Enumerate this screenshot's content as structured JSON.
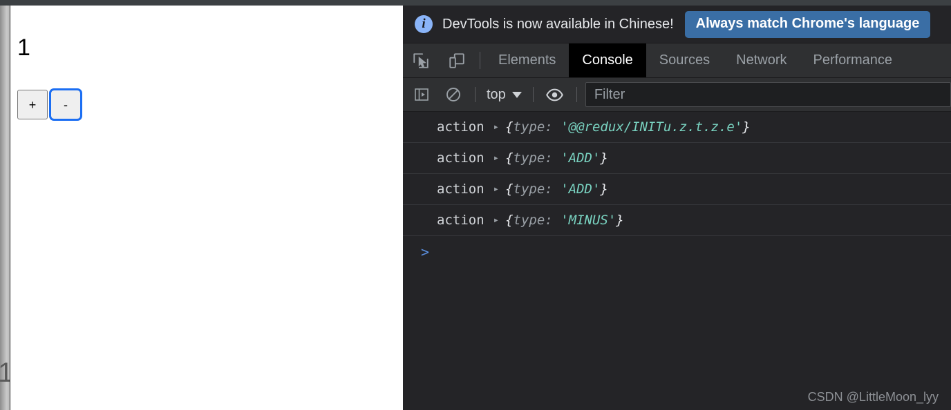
{
  "page": {
    "counter_value": "1",
    "gutter_ghost_char": "1",
    "buttons": [
      {
        "label": "+",
        "name": "increment-button",
        "focused": false
      },
      {
        "label": "-",
        "name": "decrement-button",
        "focused": true
      }
    ]
  },
  "devtools": {
    "banner": {
      "icon": "info-icon",
      "message": "DevTools is now available in Chinese!",
      "action_label": "Always match Chrome's language"
    },
    "toolbar_icons": [
      {
        "name": "inspect-element-icon",
        "title": "Inspect"
      },
      {
        "name": "device-toolbar-icon",
        "title": "Toggle device toolbar"
      }
    ],
    "tabs": [
      {
        "label": "Elements",
        "active": false
      },
      {
        "label": "Console",
        "active": true
      },
      {
        "label": "Sources",
        "active": false
      },
      {
        "label": "Network",
        "active": false
      },
      {
        "label": "Performance",
        "active": false
      }
    ],
    "console_toolbar": {
      "sidebar_toggle_icon": "console-sidebar-icon",
      "clear_icon": "clear-console-icon",
      "context_label": "top",
      "eye_icon": "live-expression-eye-icon",
      "filter_placeholder": "Filter",
      "filter_value": ""
    },
    "logs": [
      {
        "label": "action",
        "disclosure": "▸",
        "open_brace": "{",
        "key": "type:",
        "value": "'@@redux/INITu.z.t.z.e'",
        "close_brace": "}"
      },
      {
        "label": "action",
        "disclosure": "▸",
        "open_brace": "{",
        "key": "type:",
        "value": "'ADD'",
        "close_brace": "}"
      },
      {
        "label": "action",
        "disclosure": "▸",
        "open_brace": "{",
        "key": "type:",
        "value": "'ADD'",
        "close_brace": "}"
      },
      {
        "label": "action",
        "disclosure": "▸",
        "open_brace": "{",
        "key": "type:",
        "value": "'MINUS'",
        "close_brace": "}"
      }
    ],
    "prompt_caret": ">",
    "watermark": "CSDN @LittleMoon_lyy"
  },
  "colors": {
    "banner_action_bg": "#3a6ea5",
    "info_icon_bg": "#8ab4f8",
    "string_token": "#79d2c0",
    "focus_ring": "#1b6ef3",
    "devtools_bg": "#242427",
    "toolbar_bg": "#2f3032"
  }
}
